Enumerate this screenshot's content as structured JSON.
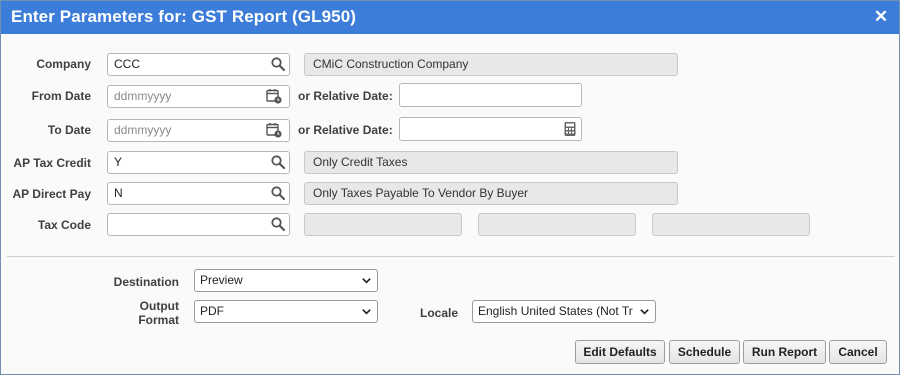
{
  "window": {
    "title": "Enter Parameters for: GST Report (GL950)",
    "close_glyph": "✕"
  },
  "form": {
    "company": {
      "label": "Company",
      "value": "CCC",
      "description": "CMiC Construction Company"
    },
    "from_date": {
      "label": "From Date",
      "placeholder": "ddmmyyyy",
      "relative_label": "or Relative Date:",
      "relative_value": ""
    },
    "to_date": {
      "label": "To Date",
      "placeholder": "ddmmyyyy",
      "relative_label": "or Relative Date:",
      "relative_value": ""
    },
    "ap_tax_credit": {
      "label": "AP Tax Credit",
      "value": "Y",
      "description": "Only Credit Taxes"
    },
    "ap_direct_pay": {
      "label": "AP Direct Pay",
      "value": "N",
      "description": "Only Taxes Payable To Vendor By Buyer"
    },
    "tax_code": {
      "label": "Tax Code",
      "value": "",
      "description_1": "",
      "description_2": "",
      "description_3": ""
    }
  },
  "output": {
    "destination_label": "Destination",
    "destination_value": "Preview",
    "format_label_line1": "Output",
    "format_label_line2": "Format",
    "format_value": "PDF",
    "locale_label": "Locale",
    "locale_value": "English United States (Not Tr"
  },
  "buttons": {
    "edit_defaults": "Edit Defaults",
    "schedule": "Schedule",
    "run_report": "Run Report",
    "cancel": "Cancel"
  },
  "icons": {
    "lookup": "search-icon",
    "date": "calendar-clock-icon",
    "calculator": "calculator-icon",
    "dropdown": "chevron-down-icon",
    "close": "close-icon"
  },
  "colors": {
    "titlebar": "#3b7dd8",
    "readonly_field": "#e8e8e8",
    "label_text": "#404040"
  }
}
